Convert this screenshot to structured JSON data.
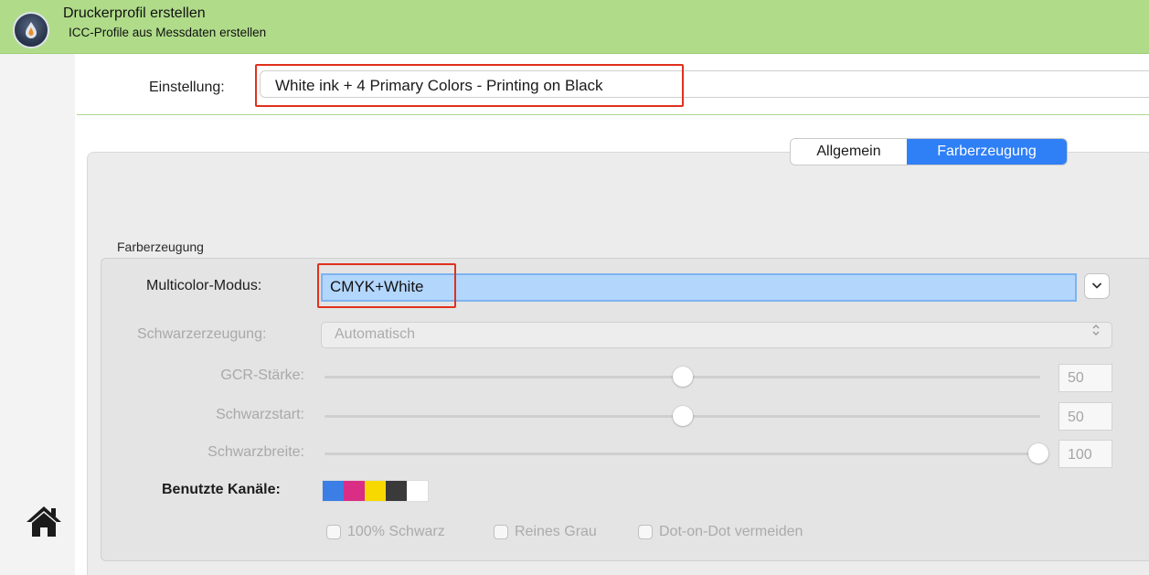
{
  "header": {
    "title": "Druckerprofil erstellen",
    "subtitle": "ICC-Profile aus Messdaten erstellen"
  },
  "einstellung": {
    "label": "Einstellung:",
    "value": "White ink + 4 Primary Colors - Printing on Black"
  },
  "tabs": [
    {
      "label": "Allgemein",
      "selected": false
    },
    {
      "label": "Farberzeugung",
      "selected": true
    }
  ],
  "group": {
    "title": "Farberzeugung",
    "multicolor_label": "Multicolor-Modus:",
    "multicolor_value": "CMYK+White",
    "schwarz_label": "Schwarzerzeugung:",
    "schwarz_value": "Automatisch",
    "sliders": [
      {
        "label": "GCR-Stärke:",
        "value": "50",
        "fraction": 0.5
      },
      {
        "label": "Schwarzstart:",
        "value": "50",
        "fraction": 0.5
      },
      {
        "label": "Schwarzbreite:",
        "value": "100",
        "fraction": 1.0
      }
    ],
    "channels_label": "Benutzte Kanäle:",
    "channels": [
      "#3b7ee6",
      "#d92d86",
      "#f7d900",
      "#3a3a3a",
      "#ffffff"
    ],
    "checkboxes": [
      {
        "label": "100% Schwarz",
        "checked": false
      },
      {
        "label": "Reines Grau",
        "checked": false
      },
      {
        "label": "Dot-on-Dot vermeiden",
        "checked": false
      }
    ]
  },
  "icons": {
    "logo": "app-logo-icon",
    "home": "home-icon"
  },
  "colors": {
    "header_bg": "#b0dc8a",
    "highlight": "#e0311c",
    "accent": "#2f7ff6",
    "selection": "#b3d6fc"
  }
}
